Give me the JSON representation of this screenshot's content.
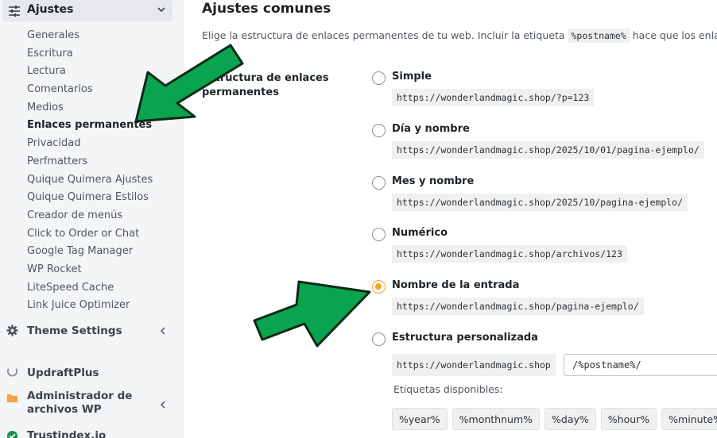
{
  "sidebar": {
    "menu_title": "Ajustes",
    "items": [
      {
        "label": "Generales"
      },
      {
        "label": "Escritura"
      },
      {
        "label": "Lectura"
      },
      {
        "label": "Comentarios"
      },
      {
        "label": "Medios"
      },
      {
        "label": "Enlaces permanentes",
        "active": true
      },
      {
        "label": "Privacidad"
      },
      {
        "label": "Perfmatters"
      },
      {
        "label": "Quique Quimera Ajustes"
      },
      {
        "label": "Quique Quimera Estilos"
      },
      {
        "label": "Creador de menús"
      },
      {
        "label": "Click to Order or Chat"
      },
      {
        "label": "Google Tag Manager"
      },
      {
        "label": "WP Rocket"
      },
      {
        "label": "LiteSpeed Cache"
      },
      {
        "label": "Link Juice Optimizer"
      }
    ],
    "theme_settings": "Theme Settings",
    "updraftplus": "UpdraftPlus",
    "file_manager": "Administrador de archivos WP",
    "trustindex": "Trustindex.io"
  },
  "main": {
    "title": "Ajustes comunes",
    "description_before": "Elige la estructura de enlaces permanentes de tu web. Incluir la etiqueta",
    "description_tag": "%postname%",
    "description_after": "hace que los enlaces sean",
    "field_label": "Estructura de enlaces permanentes",
    "options": [
      {
        "label": "Simple",
        "url": "https://wonderlandmagic.shop/?p=123",
        "checked": false
      },
      {
        "label": "Día y nombre",
        "url": "https://wonderlandmagic.shop/2025/10/01/pagina-ejemplo/",
        "checked": false
      },
      {
        "label": "Mes y nombre",
        "url": "https://wonderlandmagic.shop/2025/10/pagina-ejemplo/",
        "checked": false
      },
      {
        "label": "Numérico",
        "url": "https://wonderlandmagic.shop/archivos/123",
        "checked": false
      },
      {
        "label": "Nombre de la entrada",
        "url": "https://wonderlandmagic.shop/pagina-ejemplo/",
        "checked": true
      },
      {
        "label": "Estructura personalizada",
        "checked": false
      }
    ],
    "custom_prefix": "https://wonderlandmagic.shop",
    "custom_value": "/%postname%/",
    "tags_label": "Etiquetas disponibles:",
    "tags": [
      "%year%",
      "%monthnum%",
      "%day%",
      "%hour%",
      "%minute%"
    ]
  },
  "colors": {
    "accent": "#f5a623",
    "arrow_fill": "#0aa34f",
    "arrow_stroke": "#0b2a16"
  }
}
